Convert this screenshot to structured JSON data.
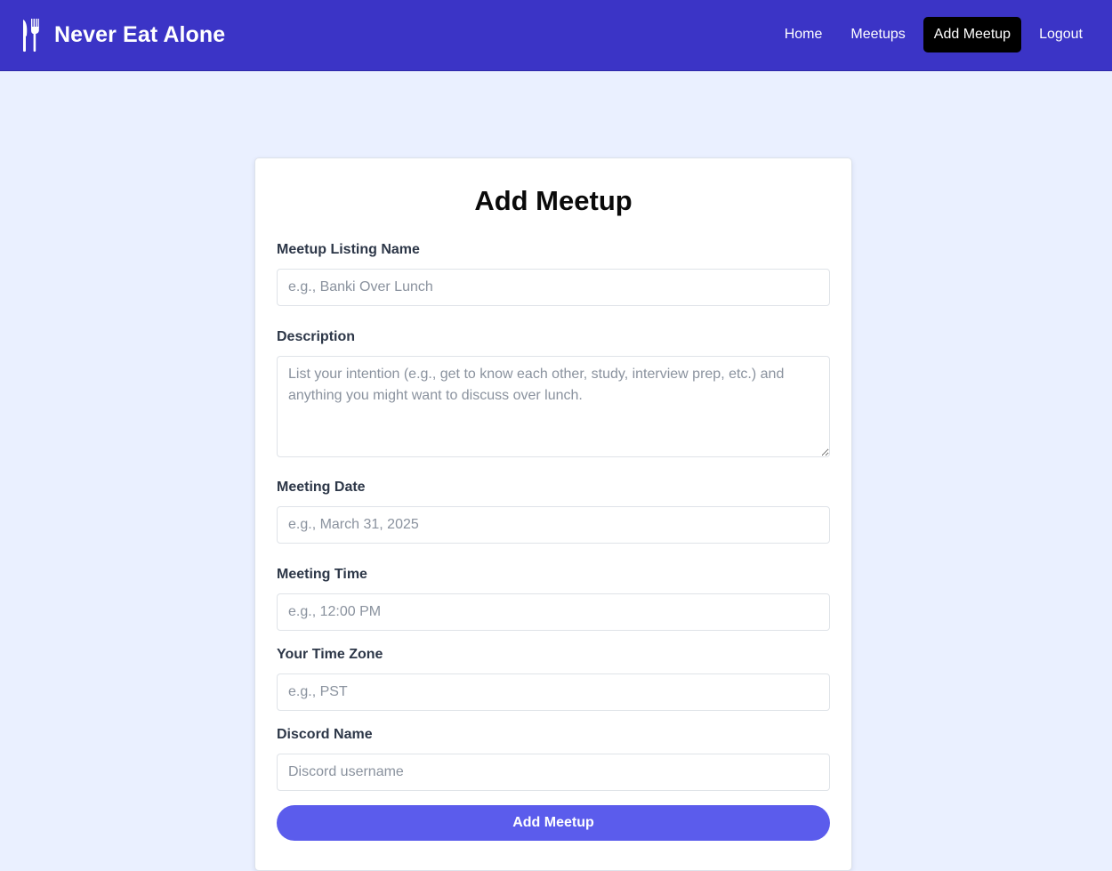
{
  "navbar": {
    "brand": {
      "title": "Never Eat Alone",
      "icon": "fork-knife-icon"
    },
    "links": [
      {
        "label": "Home",
        "active": false
      },
      {
        "label": "Meetups",
        "active": false
      },
      {
        "label": "Add Meetup",
        "active": true
      },
      {
        "label": "Logout",
        "active": false
      }
    ]
  },
  "form": {
    "title": "Add Meetup",
    "fields": {
      "name": {
        "label": "Meetup Listing Name",
        "placeholder": "e.g., Banki Over Lunch",
        "value": ""
      },
      "description": {
        "label": "Description",
        "placeholder": "List your intention (e.g., get to know each other, study, interview prep, etc.) and anything you might want to discuss over lunch.",
        "value": ""
      },
      "date": {
        "label": "Meeting Date",
        "placeholder": "e.g., March 31, 2025",
        "value": ""
      },
      "time": {
        "label": "Meeting Time",
        "placeholder": "e.g., 12:00 PM",
        "value": ""
      },
      "timezone": {
        "label": "Your Time Zone",
        "placeholder": "e.g., PST",
        "value": ""
      },
      "discord": {
        "label": "Discord Name",
        "placeholder": "Discord username",
        "value": ""
      }
    },
    "submit_label": "Add Meetup"
  },
  "colors": {
    "navbar_bg": "#3b34c6",
    "page_bg": "#eaf0ff",
    "active_link_bg": "#000000",
    "button_bg": "#5b5cec"
  }
}
